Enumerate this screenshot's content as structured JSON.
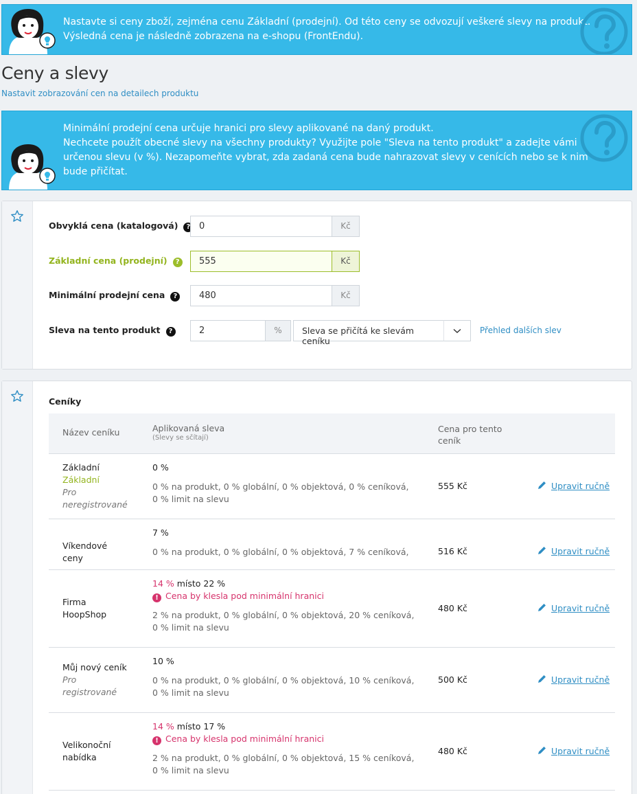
{
  "info_top": {
    "line1": "Nastavte si ceny zboží, zejména cenu Základní (prodejní). Od této ceny se odvozují veškeré slevy na produkt.",
    "line2": "Výsledná cena je následně zobrazena na e-shopu (FrontEndu)."
  },
  "page": {
    "title": "Ceny a slevy",
    "link": "Nastavit zobrazování cen na detailech produktu"
  },
  "info_min": {
    "line1": "Minimální prodejní cena určuje hranici pro slevy aplikované na daný produkt.",
    "line2": "Nechcete použít obecné slevy na všechny produkty? Využijte pole \"Sleva na tento produkt\" a zadejte vámi",
    "line3": "určenou slevu (v %). Nezapomeňte vybrat, zda zadaná cena bude nahrazovat slevy v cenících nebo se k nim",
    "line4": "bude přičítat."
  },
  "form": {
    "catalog_label": "Obvyklá cena (katalogová)",
    "catalog_value": "0",
    "catalog_unit": "Kč",
    "base_label": "Základní cena (prodejní)",
    "base_value": "555",
    "base_unit": "Kč",
    "min_label": "Minimální prodejní cena",
    "min_value": "480",
    "min_unit": "Kč",
    "discount_label": "Sleva na tento produkt",
    "discount_value": "2",
    "discount_unit": "%",
    "discount_mode": "Sleva se přičítá ke slevám ceníku",
    "other_discounts_link": "Přehled dalších slev",
    "help_glyph": "?"
  },
  "lists": {
    "title": "Ceníky",
    "col_name": "Název ceníku",
    "col_discount": "Aplikovaná sleva",
    "col_discount_sub": "(Slevy se sčítají)",
    "col_price_1": "Cena pro tento",
    "col_price_2": "ceník",
    "edit_label": "Upravit ručně",
    "warn_text": "Cena by klesla pod minimální hranici",
    "warn_glyph": "!",
    "rows": [
      {
        "name": "Základní",
        "name_green": "Základní",
        "name_ital_1": "Pro",
        "name_ital_2": "neregistrované",
        "pct": "0 %",
        "detail_1": "0 % na produkt, 0 % globální, 0 % objektová, 0 % ceníková,",
        "detail_2": "0 % limit na slevu",
        "price": "555 Kč"
      },
      {
        "name_1": "Víkendové",
        "name_2": "ceny",
        "pct": "7 %",
        "detail_1": "0 % na produkt, 0 % globální, 0 % objektová, 7 % ceníková,",
        "price": "516 Kč"
      },
      {
        "name_1": "Firma",
        "name_2": "HoopShop",
        "pct_red": "14 %",
        "pct_rest": " místo 22 %",
        "detail_1": "2 % na produkt, 0 % globální, 0 % objektová, 20 % ceníková,",
        "detail_2": "0 % limit na slevu",
        "price": "480 Kč"
      },
      {
        "name": "Můj nový ceník",
        "name_ital_1": "Pro",
        "name_ital_2": "registrované",
        "pct": "10 %",
        "detail_1": "0 % na produkt, 0 % globální, 0 % objektová, 10 % ceníková,",
        "detail_2": "0 % limit na slevu",
        "price": "500 Kč"
      },
      {
        "name_1": "Velikonoční",
        "name_2": "nabídka",
        "pct_red": "14 %",
        "pct_rest": " místo 17 %",
        "detail_1": "2 % na produkt, 0 % globální, 0 % objektová, 15 % ceníková,",
        "detail_2": "0 % limit na slevu",
        "price": "480 Kč"
      }
    ]
  },
  "colors": {
    "info_bg": "#36b9e8",
    "accent_green": "#93b41e",
    "link_blue": "#2f8ec4",
    "warn_red": "#d6336c"
  }
}
